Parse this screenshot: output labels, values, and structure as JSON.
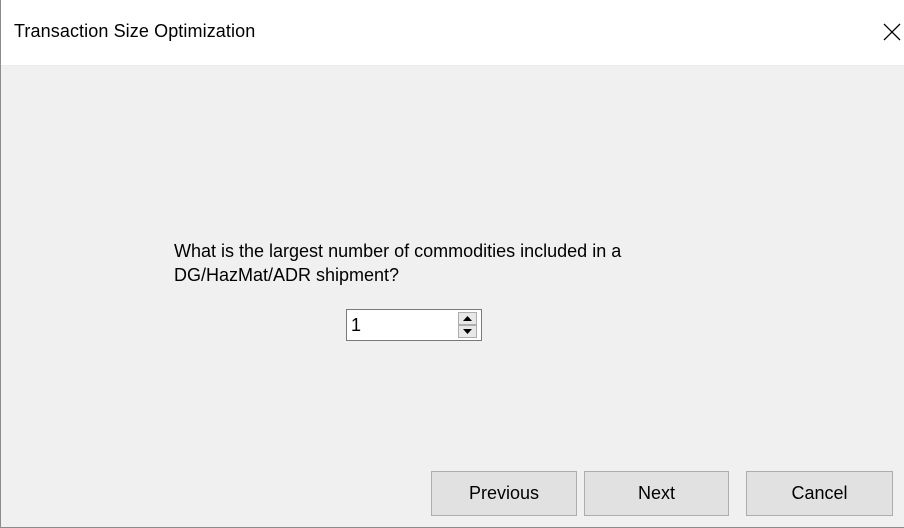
{
  "window": {
    "title": "Transaction Size Optimization",
    "close_icon": "close-icon"
  },
  "main": {
    "question": "What is the largest number of commodities included in a\nDG/HazMat/ADR shipment?",
    "spinner": {
      "value": "1",
      "up_icon": "arrow-up-icon",
      "down_icon": "arrow-down-icon"
    }
  },
  "buttons": {
    "previous": "Previous",
    "next": "Next",
    "cancel": "Cancel"
  }
}
